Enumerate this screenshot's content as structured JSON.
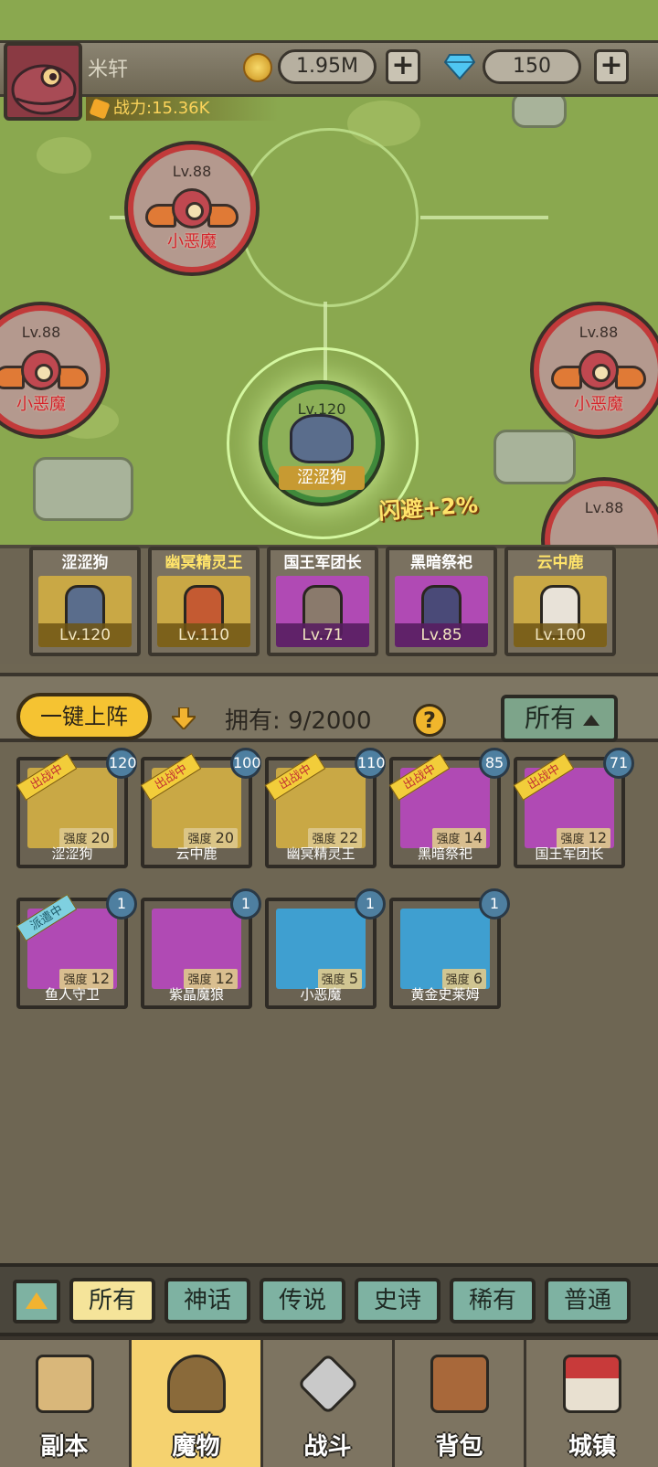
{
  "player": {
    "name": "米轩",
    "power": "战力:15.36K",
    "gold": "1.95M",
    "gems": "150",
    "plus": "+"
  },
  "map": {
    "nodes": [
      {
        "lv": "Lv.88",
        "name": "小恶魔"
      },
      {
        "lv": "Lv.88",
        "name": "小恶魔"
      },
      {
        "lv": "Lv.88",
        "name": "小恶魔"
      },
      {
        "lv": "Lv.88",
        "name": ""
      }
    ],
    "center": {
      "lv": "Lv.120",
      "name": "涩涩狗"
    },
    "bonus": "闪避+2%"
  },
  "lineup": [
    {
      "name": "涩涩狗",
      "lv": "Lv.120",
      "rarity": "gold"
    },
    {
      "name": "幽冥精灵王",
      "lv": "Lv.110",
      "rarity": "gold"
    },
    {
      "name": "国王军团长",
      "lv": "Lv.71",
      "rarity": "purple"
    },
    {
      "name": "黑暗祭祀",
      "lv": "Lv.85",
      "rarity": "purple"
    },
    {
      "name": "云中鹿",
      "lv": "Lv.100",
      "rarity": "gold"
    }
  ],
  "toolbar": {
    "deploy": "一键上阵",
    "owned": "拥有: 9/2000",
    "help": "?",
    "filter": "所有"
  },
  "monsters": [
    {
      "name": "涩涩狗",
      "level": "120",
      "power_label": "强度",
      "power": "20",
      "tag": "出战中",
      "color": "#c9a845"
    },
    {
      "name": "云中鹿",
      "level": "100",
      "power_label": "强度",
      "power": "20",
      "tag": "出战中",
      "color": "#c9a845"
    },
    {
      "name": "幽冥精灵王",
      "level": "110",
      "power_label": "强度",
      "power": "22",
      "tag": "出战中",
      "color": "#c9a845"
    },
    {
      "name": "黑暗祭祀",
      "level": "85",
      "power_label": "强度",
      "power": "14",
      "tag": "出战中",
      "color": "#b04ab4"
    },
    {
      "name": "国王军团长",
      "level": "71",
      "power_label": "强度",
      "power": "12",
      "tag": "出战中",
      "color": "#b04ab4"
    },
    {
      "name": "鱼人守卫",
      "level": "1",
      "power_label": "强度",
      "power": "12",
      "tag": "派遣中",
      "color": "#b04ab4"
    },
    {
      "name": "紫晶魔狼",
      "level": "1",
      "power_label": "强度",
      "power": "12",
      "tag": "",
      "color": "#b04ab4"
    },
    {
      "name": "小恶魔",
      "level": "1",
      "power_label": "强度",
      "power": "5",
      "tag": "",
      "color": "#3f9fd0"
    },
    {
      "name": "黄金史莱姆",
      "level": "1",
      "power_label": "强度",
      "power": "6",
      "tag": "",
      "color": "#3f9fd0"
    }
  ],
  "rarity_filters": [
    "所有",
    "神话",
    "传说",
    "史诗",
    "稀有",
    "普通"
  ],
  "nav": [
    {
      "label": "副本",
      "icon": "map-scroll-icon"
    },
    {
      "label": "魔物",
      "icon": "monster-helmet-icon"
    },
    {
      "label": "战斗",
      "icon": "crossed-swords-icon"
    },
    {
      "label": "背包",
      "icon": "backpack-icon"
    },
    {
      "label": "城镇",
      "icon": "town-shop-icon"
    }
  ]
}
